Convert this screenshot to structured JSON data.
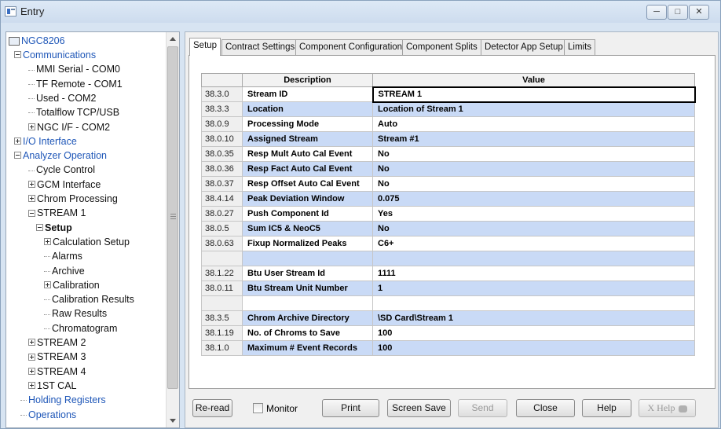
{
  "window": {
    "title": "Entry"
  },
  "tree": {
    "root": "NGC8206",
    "items": [
      {
        "label": "Communications",
        "expander": "minus",
        "link": true
      },
      {
        "label": "MMI Serial - COM0"
      },
      {
        "label": "TF Remote - COM1"
      },
      {
        "label": "Used - COM2"
      },
      {
        "label": "Totalflow TCP/USB"
      },
      {
        "label": "NGC I/F - COM2",
        "expander": "plus"
      },
      {
        "label": "I/O Interface",
        "expander": "plus",
        "link": true
      },
      {
        "label": "Analyzer Operation",
        "expander": "minus",
        "link": true
      },
      {
        "label": "Cycle Control"
      },
      {
        "label": "GCM Interface",
        "expander": "plus"
      },
      {
        "label": "Chrom Processing",
        "expander": "plus"
      },
      {
        "label": "STREAM 1",
        "expander": "minus"
      },
      {
        "label": "Setup",
        "expander": "minus",
        "bold": true
      },
      {
        "label": "Calculation Setup",
        "expander": "plus"
      },
      {
        "label": "Alarms"
      },
      {
        "label": "Archive"
      },
      {
        "label": "Calibration",
        "expander": "plus"
      },
      {
        "label": "Calibration Results"
      },
      {
        "label": "Raw Results"
      },
      {
        "label": "Chromatogram"
      },
      {
        "label": "STREAM 2",
        "expander": "plus"
      },
      {
        "label": "STREAM 3",
        "expander": "plus"
      },
      {
        "label": "STREAM 4",
        "expander": "plus"
      },
      {
        "label": "1ST CAL",
        "expander": "plus"
      },
      {
        "label": "Holding Registers",
        "link": true
      },
      {
        "label": "Operations",
        "link": true
      }
    ]
  },
  "tabs": [
    {
      "label": "Setup",
      "active": true
    },
    {
      "label": "Contract Settings"
    },
    {
      "label": "Component Configuration"
    },
    {
      "label": "Component Splits"
    },
    {
      "label": "Detector App Setup"
    },
    {
      "label": "Limits"
    }
  ],
  "grid": {
    "headers": {
      "description": "Description",
      "value": "Value"
    },
    "rows": [
      {
        "reg": "38.3.0",
        "desc": "Stream ID",
        "value": "STREAM 1"
      },
      {
        "reg": "38.3.3",
        "desc": "Location",
        "value": "Location of Stream 1"
      },
      {
        "reg": "38.0.9",
        "desc": "Processing Mode",
        "value": "Auto"
      },
      {
        "reg": "38.0.10",
        "desc": "Assigned Stream",
        "value": "Stream #1"
      },
      {
        "reg": "38.0.35",
        "desc": "Resp Mult Auto Cal Event",
        "value": "No"
      },
      {
        "reg": "38.0.36",
        "desc": "Resp Fact Auto Cal Event",
        "value": "No"
      },
      {
        "reg": "38.0.37",
        "desc": "Resp Offset Auto Cal Event",
        "value": "No"
      },
      {
        "reg": "38.4.14",
        "desc": "Peak Deviation Window",
        "value": "0.075"
      },
      {
        "reg": "38.0.27",
        "desc": "Push Component Id",
        "value": "Yes"
      },
      {
        "reg": "38.0.5",
        "desc": "Sum IC5 & NeoC5",
        "value": "No"
      },
      {
        "reg": "38.0.63",
        "desc": "Fixup Normalized Peaks",
        "value": "C6+"
      },
      {
        "reg": "",
        "desc": "",
        "value": ""
      },
      {
        "reg": "38.1.22",
        "desc": "Btu User Stream Id",
        "value": "1111"
      },
      {
        "reg": "38.0.11",
        "desc": "Btu Stream Unit Number",
        "value": "1"
      },
      {
        "reg": "",
        "desc": "",
        "value": ""
      },
      {
        "reg": "38.3.5",
        "desc": "Chrom Archive Directory",
        "value": "\\SD Card\\Stream 1"
      },
      {
        "reg": "38.1.19",
        "desc": "No. of Chroms to Save",
        "value": "100"
      },
      {
        "reg": "38.1.0",
        "desc": "Maximum # Event Records",
        "value": "100"
      }
    ]
  },
  "buttons": {
    "reread": "Re-read",
    "monitor": "Monitor",
    "print": "Print",
    "screen_save": "Screen Save",
    "send": "Send",
    "close": "Close",
    "help": "Help",
    "xhelp": "X Help"
  }
}
